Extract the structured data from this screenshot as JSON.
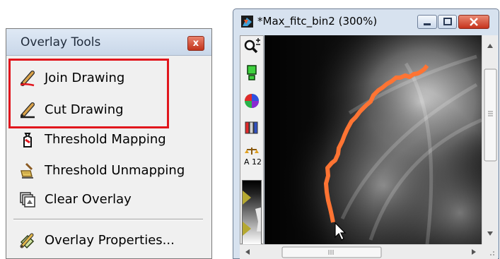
{
  "menu": {
    "title": "Overlay Tools",
    "close_symbol": "x",
    "items": [
      {
        "label": "Join Drawing",
        "icon": "pencil-icon"
      },
      {
        "label": "Cut Drawing",
        "icon": "pencil-icon"
      },
      {
        "label": "Threshold Mapping",
        "icon": "threshold-mapping-icon"
      },
      {
        "label": "Threshold Unmapping",
        "icon": "threshold-unmapping-icon"
      },
      {
        "label": "Clear Overlay",
        "icon": "clear-overlay-icon"
      },
      {
        "label": "Overlay Properties...",
        "icon": "overlay-properties-icon"
      }
    ]
  },
  "window": {
    "title": "*Max_fitc_bin2 (300%)",
    "toolbar": {
      "calibration_label": "A 12"
    }
  },
  "colors": {
    "highlight": "#e1161d",
    "overlay_trace": "#ff7433"
  }
}
